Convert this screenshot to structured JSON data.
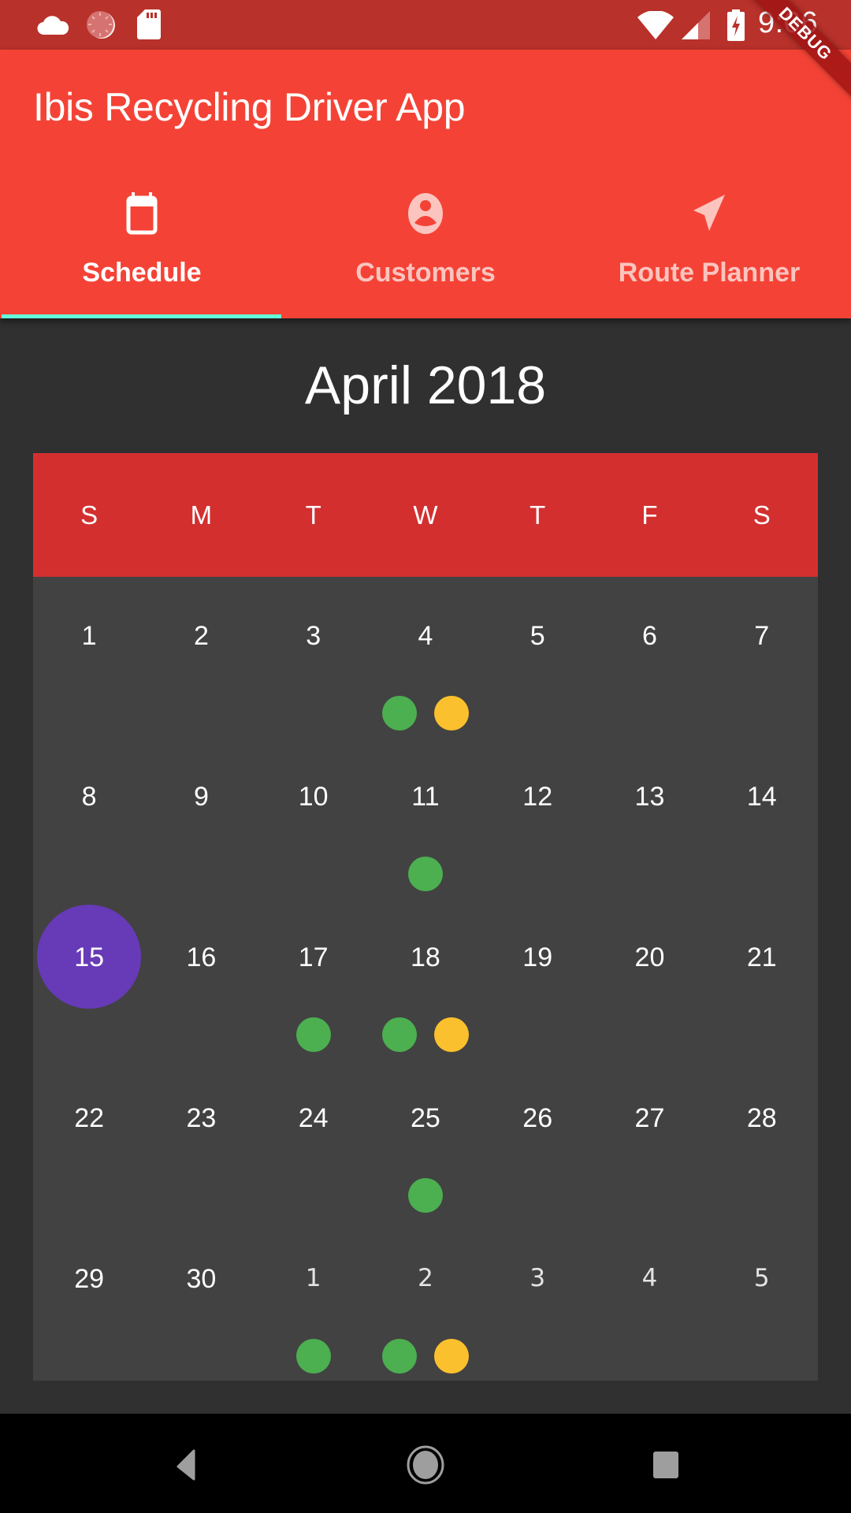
{
  "status_bar": {
    "time": "9:06",
    "left_icons": [
      "cloud-icon",
      "sync-loading-icon",
      "sd-card-icon"
    ],
    "right_icons": [
      "wifi-icon",
      "cell-signal-icon",
      "battery-charging-icon"
    ]
  },
  "debug_banner": "DEBUG",
  "app_bar": {
    "title": "Ibis Recycling Driver App",
    "tabs": [
      {
        "label": "Schedule",
        "icon": "calendar-icon",
        "selected": true
      },
      {
        "label": "Customers",
        "icon": "account-circle-icon",
        "selected": false
      },
      {
        "label": "Route Planner",
        "icon": "navigation-icon",
        "selected": false
      }
    ]
  },
  "colors": {
    "status_bar": "#b8312a",
    "app_bar": "#f44336",
    "tab_indicator": "#64ffda",
    "weekday_header": "#d32f2f",
    "grid_background": "#424242",
    "page_background": "#303030",
    "today": "#673ab7",
    "event_green": "#4caf50",
    "event_yellow": "#fbc02d"
  },
  "calendar": {
    "month_title": "April 2018",
    "weekdays": [
      "S",
      "M",
      "T",
      "W",
      "T",
      "F",
      "S"
    ],
    "today": 15,
    "weeks": [
      [
        {
          "day": "1",
          "dots": []
        },
        {
          "day": "2",
          "dots": []
        },
        {
          "day": "3",
          "dots": []
        },
        {
          "day": "4",
          "dots": [
            "green",
            "yellow"
          ]
        },
        {
          "day": "5",
          "dots": []
        },
        {
          "day": "6",
          "dots": []
        },
        {
          "day": "7",
          "dots": []
        }
      ],
      [
        {
          "day": "8",
          "dots": []
        },
        {
          "day": "9",
          "dots": []
        },
        {
          "day": "10",
          "dots": []
        },
        {
          "day": "11",
          "dots": [
            "green"
          ]
        },
        {
          "day": "12",
          "dots": []
        },
        {
          "day": "13",
          "dots": []
        },
        {
          "day": "14",
          "dots": []
        }
      ],
      [
        {
          "day": "15",
          "dots": [],
          "today": true
        },
        {
          "day": "16",
          "dots": []
        },
        {
          "day": "17",
          "dots": [
            "green"
          ]
        },
        {
          "day": "18",
          "dots": [
            "green",
            "yellow"
          ]
        },
        {
          "day": "19",
          "dots": []
        },
        {
          "day": "20",
          "dots": []
        },
        {
          "day": "21",
          "dots": []
        }
      ],
      [
        {
          "day": "22",
          "dots": []
        },
        {
          "day": "23",
          "dots": []
        },
        {
          "day": "24",
          "dots": []
        },
        {
          "day": "25",
          "dots": [
            "green"
          ]
        },
        {
          "day": "26",
          "dots": []
        },
        {
          "day": "27",
          "dots": []
        },
        {
          "day": "28",
          "dots": []
        }
      ],
      [
        {
          "day": "29",
          "dots": []
        },
        {
          "day": "30",
          "dots": []
        },
        {
          "day": "1",
          "dots": [
            "green"
          ],
          "other_month": true
        },
        {
          "day": "2",
          "dots": [
            "green",
            "yellow"
          ],
          "other_month": true
        },
        {
          "day": "3",
          "dots": [],
          "other_month": true
        },
        {
          "day": "4",
          "dots": [],
          "other_month": true
        },
        {
          "day": "5",
          "dots": [],
          "other_month": true
        }
      ]
    ]
  },
  "nav_bar": {
    "buttons": [
      "back-icon",
      "home-icon",
      "recents-icon"
    ]
  }
}
